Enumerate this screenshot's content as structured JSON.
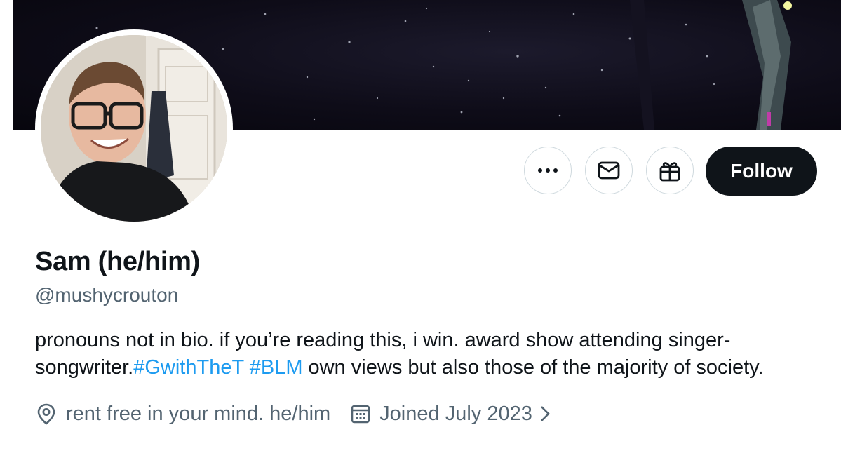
{
  "profile": {
    "display_name": "Sam (he/him)",
    "handle": "@mushycrouton",
    "bio": {
      "text_before": "pronouns not in bio. if you’re reading this, i win. award show attending singer-songwriter.",
      "hashtag_1": "#GwithTheT",
      "hashtag_2": "#BLM",
      "text_after": "own views but also those of the majority of society."
    },
    "location": "rent free in your mind. he/him",
    "joined": "Joined July 2023"
  },
  "actions": {
    "more_icon": "more-icon",
    "message_icon": "envelope-icon",
    "gift_icon": "gift-icon",
    "follow_label": "Follow"
  },
  "icons": {
    "location": "location-pin-icon",
    "calendar": "calendar-icon",
    "chevron": "chevron-right-icon"
  },
  "colors": {
    "text": "#0f1419",
    "secondary": "#536471",
    "link": "#1d9bf0",
    "button_border": "#cfd9de",
    "follow_bg": "#0f1419"
  }
}
